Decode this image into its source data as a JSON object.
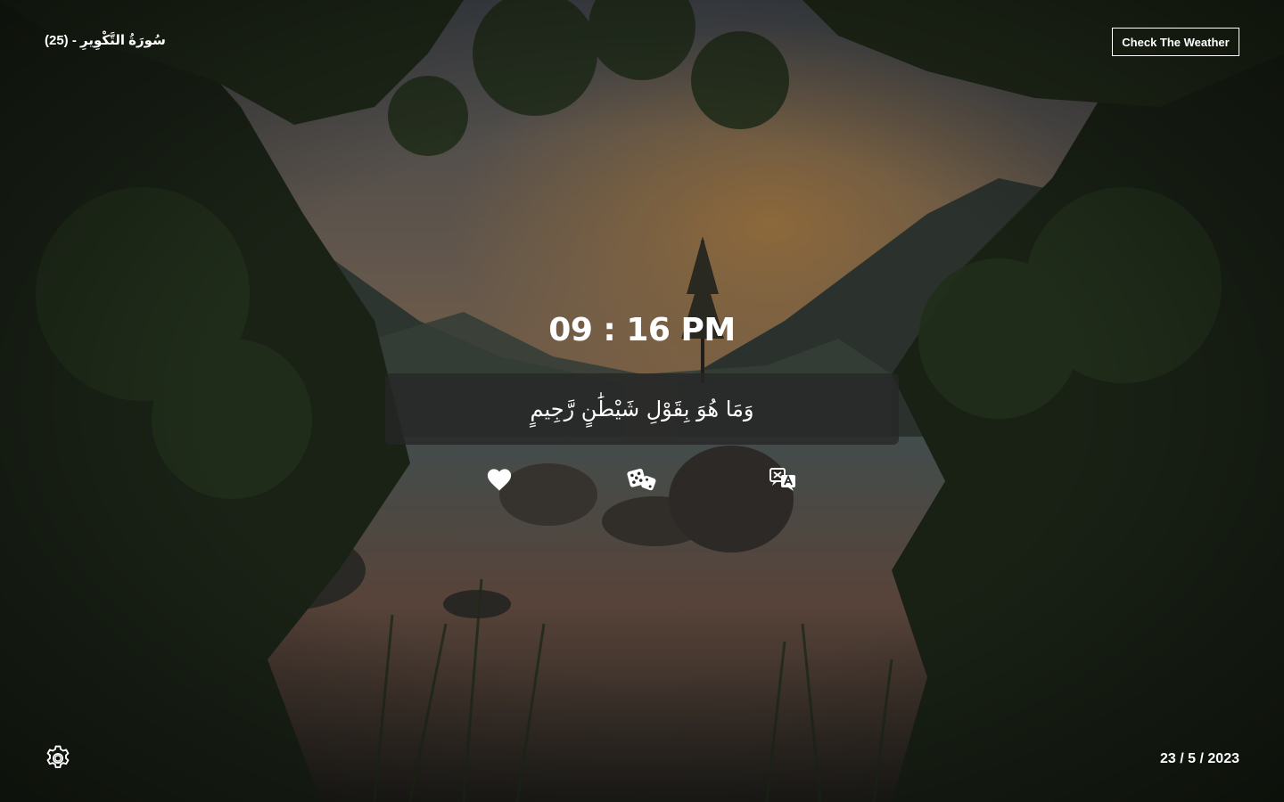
{
  "header": {
    "surah_label": "(25) - سُورَةُ التَّكْوِيرِ",
    "weather_button": "Check The Weather"
  },
  "clock": {
    "time": "09 : 16 PM"
  },
  "verse": {
    "text": "وَمَا هُوَ بِقَوْلِ شَيْطَٰنٍ رَّجِيمٍ"
  },
  "actions": [
    {
      "name": "favorite",
      "icon": "heart-icon"
    },
    {
      "name": "random",
      "icon": "dice-icon"
    },
    {
      "name": "translate",
      "icon": "translate-icon"
    }
  ],
  "footer": {
    "settings_icon": "gear-icon",
    "date": "23 / 5 / 2023"
  },
  "colors": {
    "text": "#ffffff",
    "verse_box": "rgba(38,38,38,0.78)"
  }
}
